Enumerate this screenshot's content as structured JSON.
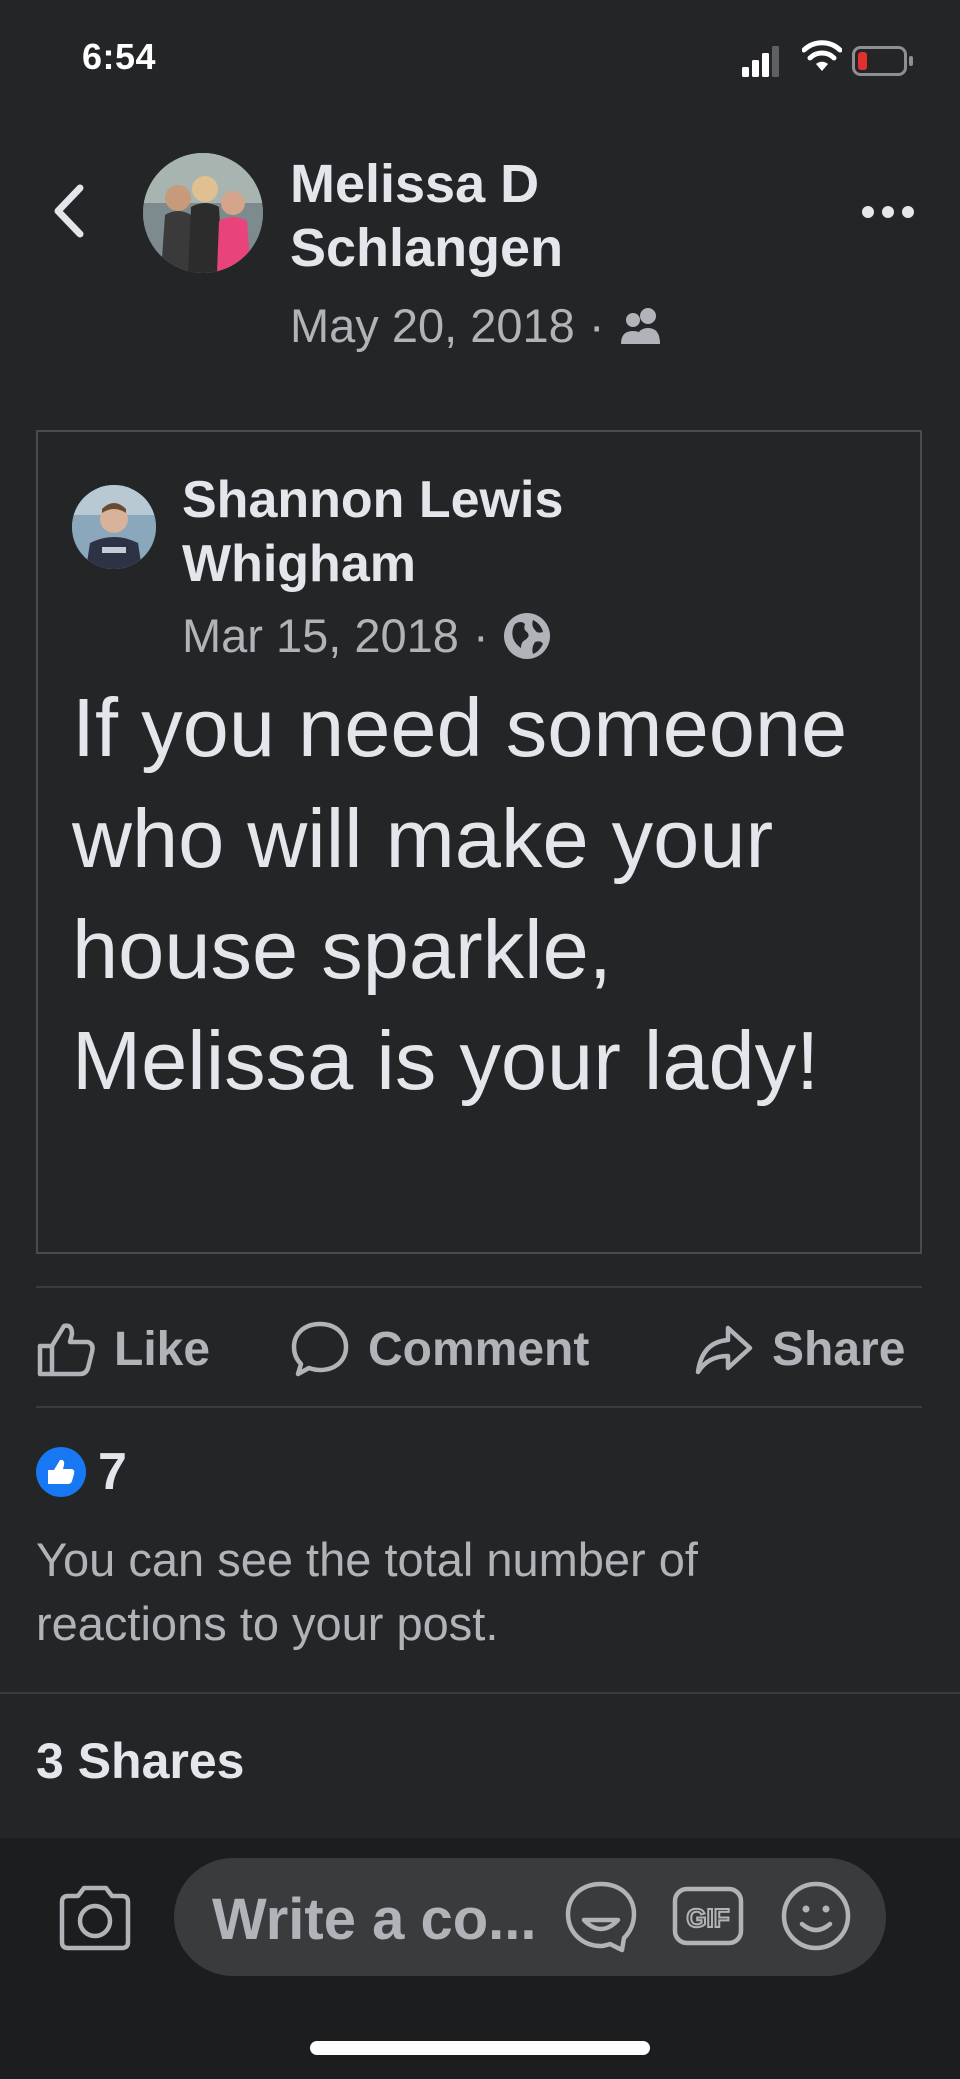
{
  "status_bar": {
    "time": "6:54",
    "battery_color": "#e0312f"
  },
  "header": {
    "author_name": "Melissa D Schlangen",
    "date": "May 20, 2018",
    "separator": "·",
    "audience_icon": "friends-icon"
  },
  "shared_post": {
    "author_name": "Shannon Lewis Whigham",
    "date": "Mar 15, 2018",
    "separator": "·",
    "audience_icon": "globe-icon",
    "text": "If you need someone who will make your house sparkle, Melissa is your lady!"
  },
  "actions": {
    "like": "Like",
    "comment": "Comment",
    "share": "Share"
  },
  "reactions": {
    "count": "7",
    "note": "You can see the total number of reactions to your post."
  },
  "shares": {
    "label": "3 Shares"
  },
  "composer": {
    "placeholder": "Write a co..."
  },
  "colors": {
    "background": "#242527",
    "accent": "#1877f2",
    "muted": "#b0b3b8",
    "text": "#e4e6eb"
  }
}
